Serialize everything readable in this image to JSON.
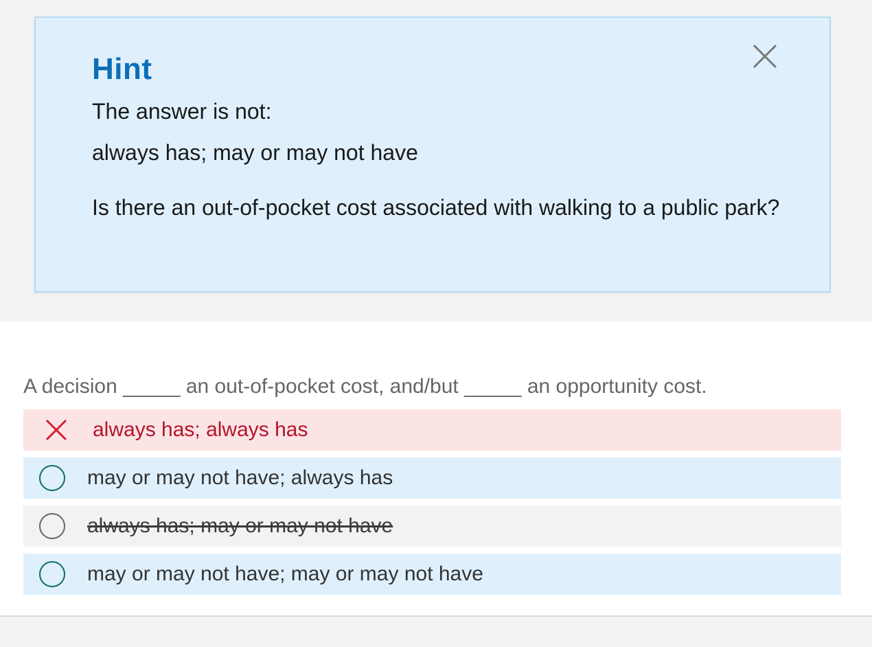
{
  "hint": {
    "title": "Hint",
    "line1": "The answer is not:",
    "line2": "always has; may or may not have",
    "line3": "Is there an out-of-pocket cost associated with walking to a public park?",
    "close_icon": "close-icon"
  },
  "question": {
    "text": "A decision _____ an out-of-pocket cost, and/but _____ an opportunity cost.",
    "options": [
      {
        "label": "always has; always has",
        "state": "incorrect"
      },
      {
        "label": "may or may not have; always has",
        "state": "available"
      },
      {
        "label": "always has; may or may not have",
        "state": "eliminated"
      },
      {
        "label": "may or may not have; may or may not have",
        "state": "available"
      }
    ]
  },
  "colors": {
    "hint_bg": "#dff0fc",
    "hint_title": "#0b6fb8",
    "incorrect_bg": "#fde4e4",
    "incorrect_text": "#b3142b",
    "radio_border": "#0f6b6b"
  }
}
